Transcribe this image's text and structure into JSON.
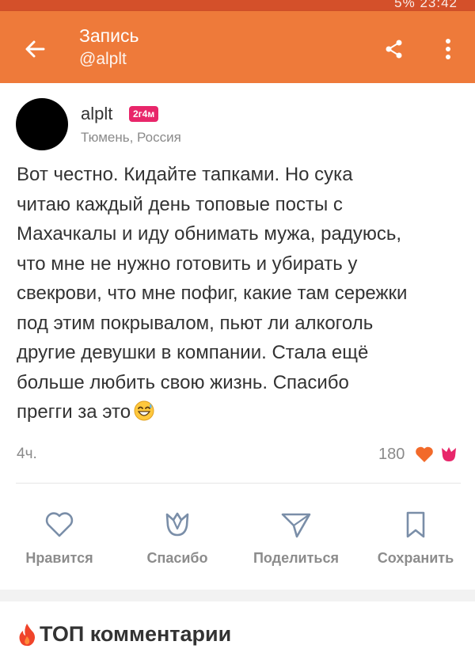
{
  "status_bar": {
    "time_text": "5% 23:42"
  },
  "header": {
    "title": "Запись",
    "subtitle": "@alplt",
    "icons": [
      "back-arrow-icon",
      "share-icon",
      "more-vertical-icon"
    ]
  },
  "post": {
    "author": "alplt",
    "badge": "2г4м",
    "location": "Тюмень, Россия",
    "text": "Вот честно. Кидайте тапками. Но сука\nчитаю каждый день топовые посты с\nМахачкалы и иду обнимать мужа, радуюсь,\nчто мне не нужно готовить и убирать у\nсвекрови, что мне пофиг, какие там сережки\nпод этим покрывалом, пьют ли алкоголь\nдругие девушки в компании. Стала  ещё\nбольше любить свою жизнь. Спасибо\nпрегги за это",
    "emoji": "grinning-sweat-emoji",
    "time": "4ч.",
    "likes_count": "180"
  },
  "actions": [
    {
      "label": "Нравится",
      "icon": "heart-icon"
    },
    {
      "label": "Спасибо",
      "icon": "tulip-icon"
    },
    {
      "label": "Поделиться",
      "icon": "send-icon"
    },
    {
      "label": "Сохранить",
      "icon": "bookmark-icon"
    }
  ],
  "comments": {
    "title": "ТОП комментарии",
    "icon": "fire-icon"
  },
  "colors": {
    "appbar": "#ee7a3a",
    "statusbar": "#d4502a",
    "badge": "#e8266a",
    "like_heart": "#f26a2a",
    "thanks_tulip": "#e8266a"
  }
}
